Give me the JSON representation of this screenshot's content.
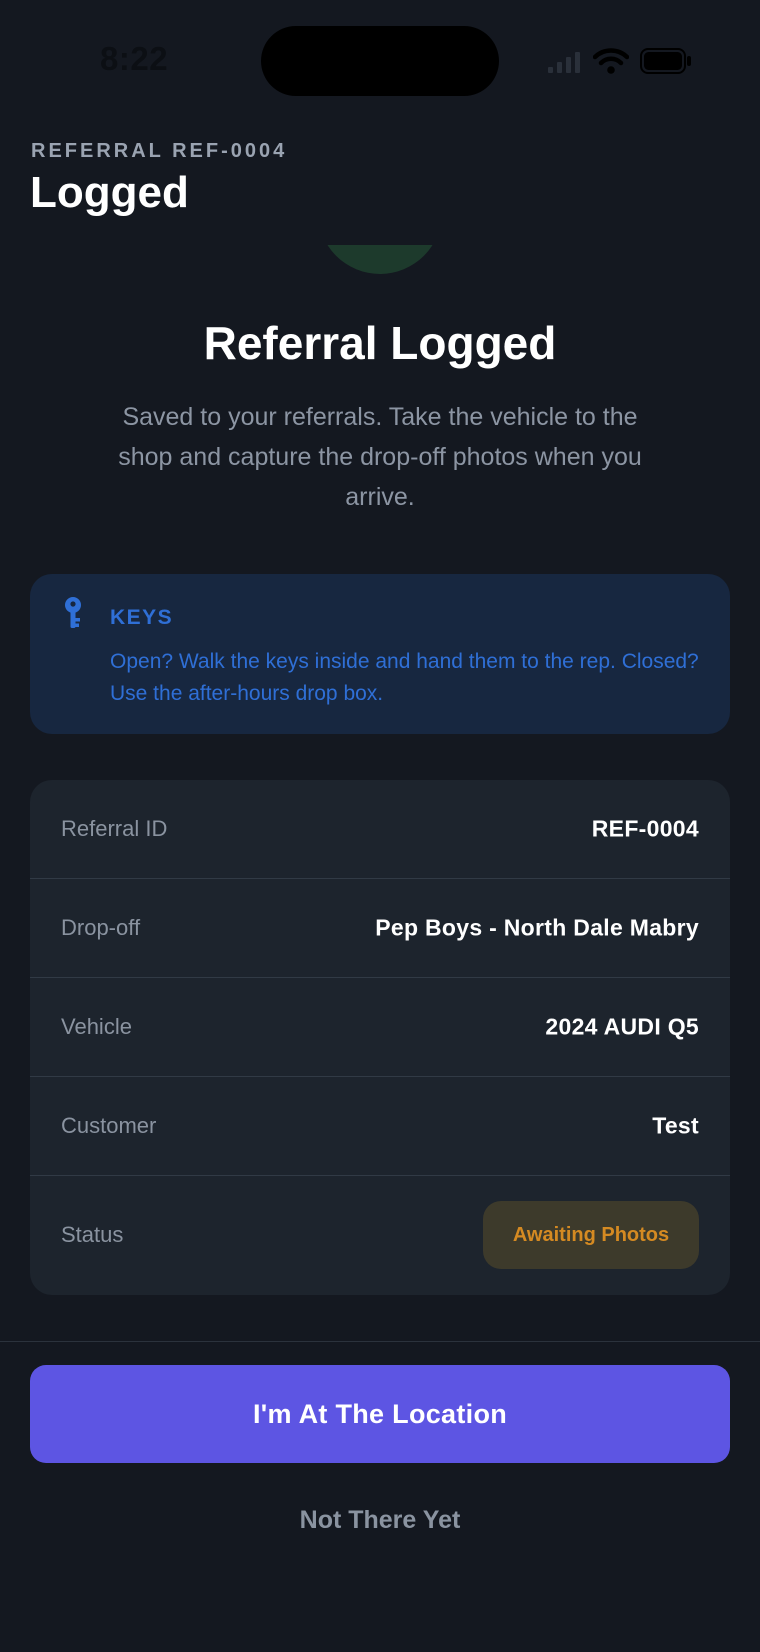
{
  "status_bar": {
    "time": "8:22"
  },
  "header": {
    "eyebrow": "REFERRAL REF-0004",
    "title": "Logged"
  },
  "confirmation": {
    "headline": "Referral Logged",
    "subtext": "Saved to your referrals. Take the vehicle to the shop and capture the drop-off photos when you arrive."
  },
  "keys_notice": {
    "icon": "key-icon",
    "title": "KEYS",
    "body": "Open? Walk the keys inside and hand them to the rep. Closed? Use the after-hours drop box."
  },
  "details": {
    "rows": [
      {
        "label": "Referral ID",
        "value": "REF-0004"
      },
      {
        "label": "Drop-off",
        "value": "Pep Boys - North Dale Mabry"
      },
      {
        "label": "Vehicle",
        "value": "2024 AUDI Q5"
      },
      {
        "label": "Customer",
        "value": "Test"
      }
    ],
    "status": {
      "label": "Status",
      "value": "Awaiting Photos"
    }
  },
  "actions": {
    "primary_label": "I'm At The Location",
    "secondary_label": "Not There Yet"
  },
  "colors": {
    "background": "#141820",
    "accent": "#5d55e3",
    "info_text": "#2f6fd6",
    "info_bg": "#172740",
    "status_warning": "#d58a22",
    "success_badge": "#1d3a2c"
  }
}
